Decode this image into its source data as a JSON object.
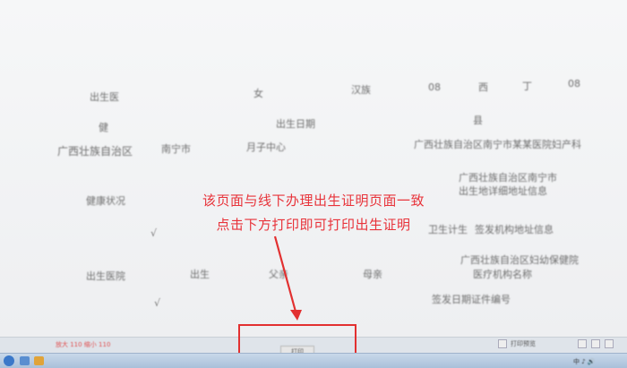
{
  "annotation": {
    "line1": "该页面与线下办理出生证明页面一致",
    "line2": "点击下方打印即可打印出生证明",
    "color": "#e8333a"
  },
  "form_rows": {
    "row1": [
      "出生医",
      "女",
      "汉族",
      "08",
      "西",
      "丁",
      "08"
    ],
    "row2": [
      "健",
      "出生日期",
      "县"
    ],
    "row3": [
      "广西壮族自治区",
      "南宁市",
      "月子中心",
      "广西壮族自治区南宁市某某医院妇产科"
    ],
    "row4": [
      "健康状况",
      "广西壮族自治区南宁市",
      "出生地详细地址信息"
    ],
    "row5": [
      "卫生计生",
      "签发机构地址信息"
    ],
    "row6": [
      "出生医院",
      "出生",
      "父亲",
      "母亲",
      "广西壮族自治区妇幼保健院",
      "医疗机构名称"
    ],
    "row7": [
      "签发日期证件编号"
    ]
  },
  "buttons": {
    "print_label": "打印"
  },
  "status": {
    "zoom_text": "放大 110 缩小 110",
    "right_label": "打印预览"
  },
  "taskbar": {
    "tray_text": "中 ♪ 🔊"
  }
}
